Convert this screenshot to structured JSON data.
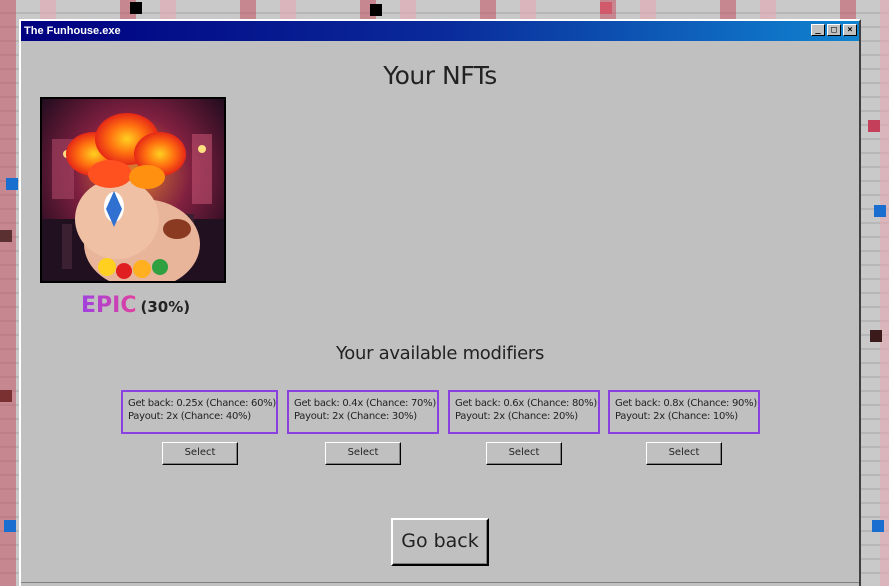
{
  "window": {
    "title": "The Funhouse.exe",
    "controls": {
      "minimize": "_",
      "maximize": "□",
      "close": "×"
    }
  },
  "nfts": {
    "heading": "Your NFTs",
    "items": [
      {
        "rarity": "EPIC",
        "chance": "(30%)"
      }
    ]
  },
  "modifiers": {
    "heading": "Your available modifiers",
    "items": [
      {
        "line1": "Get back: 0.25x (Chance: 60%)",
        "line2": "Payout: 2x (Chance: 40%)",
        "button": "Select"
      },
      {
        "line1": "Get back: 0.4x (Chance: 70%)",
        "line2": "Payout: 2x (Chance: 30%)",
        "button": "Select"
      },
      {
        "line1": "Get back: 0.6x (Chance: 80%)",
        "line2": "Payout: 2x (Chance: 20%)",
        "button": "Select"
      },
      {
        "line1": "Get back: 0.8x (Chance: 90%)",
        "line2": "Payout: 2x (Chance: 10%)",
        "button": "Select"
      }
    ]
  },
  "go_back_label": "Go back",
  "colors": {
    "titlebar": "#000080",
    "modifier_border": "#8a3fe0",
    "epic_gradient_start": "#a040e0",
    "epic_gradient_end": "#e040a0",
    "window_bg": "#c0c0c0"
  }
}
